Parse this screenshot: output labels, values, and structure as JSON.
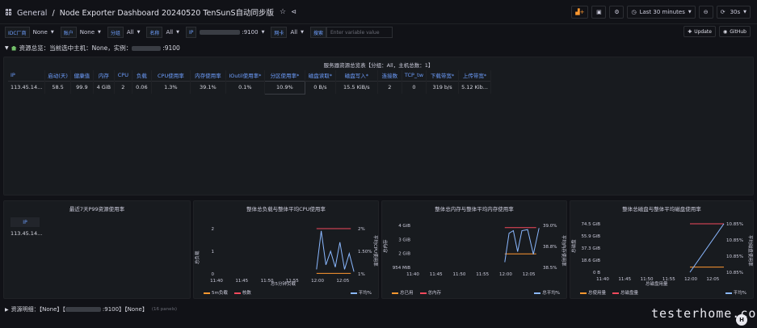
{
  "header": {
    "breadcrumb_home": "General",
    "separator": "/",
    "dashboard_title": "Node Exporter Dashboard 20240520 TenSunS自动同步版",
    "time_range": "Last 30 minutes",
    "refresh_interval": "30s"
  },
  "variables": [
    {
      "label": "IDC厂商",
      "value": "None"
    },
    {
      "label": "账户",
      "value": "None"
    },
    {
      "label": "分组",
      "value": "All"
    },
    {
      "label": "名称",
      "value": "All"
    },
    {
      "label": "IP",
      "value": ":9100"
    },
    {
      "label": "网卡",
      "value": "All"
    }
  ],
  "var_search": {
    "label": "搜索",
    "placeholder": "Enter variable value"
  },
  "buttons": {
    "update": "Update",
    "github": "GitHub"
  },
  "row_overview": {
    "label": "资源总览：当前选中主机：None，实例：",
    "suffix": ":9100"
  },
  "summary_panel": {
    "title": "服务器资源总览表【分组：All，主机总数：1】",
    "columns": [
      "IP",
      "启动(天)",
      "健康值",
      "内存",
      "CPU",
      "负载",
      "CPU使用率",
      "内存使用率",
      "IOutil使用率*",
      "分区使用率*",
      "磁盘读取*",
      "磁盘写入*",
      "连接数",
      "TCP_tw",
      "下载带宽*",
      "上传带宽*"
    ],
    "row": [
      "113.45.14...",
      "58.5",
      "99.9",
      "4 GiB",
      "2",
      "0.06",
      "1.3%",
      "39.1%",
      "0.1%",
      "10.9%",
      "0 B/s",
      "15.5 KiB/s",
      "2",
      "0",
      "319 b/s",
      "5.12 Kib..."
    ]
  },
  "p99_panel": {
    "title": "最近7天P99资源使用率",
    "column": "IP",
    "value": "113.45.14..."
  },
  "cpu_panel": {
    "title": "整体总负载与整体平均CPU使用率",
    "left_axis_label": "总负载",
    "right_axis_label": "平均CPU使用率",
    "x_axis_label": "总5分钟负载",
    "legend": [
      "5m负载",
      "核数",
      "平均%"
    ]
  },
  "mem_panel": {
    "title": "整体总内存与整体平均内存使用率",
    "left_axis_label": "总内存",
    "right_axis_label": "平均内存使用率",
    "legend": [
      "总已用",
      "总内存",
      "总平均%"
    ]
  },
  "disk_panel": {
    "title": "整体总磁盘与整体平均磁盘使用率",
    "left_axis_label": "总磁盘",
    "right_axis_label": "平均磁盘使用率",
    "x_axis_label": "总磁盘用量",
    "legend": [
      "总使用量",
      "总磁盘量",
      "平均%"
    ]
  },
  "row_detail": {
    "label": "资源明细：【None】【",
    "middle": ":9100】【None】",
    "count": "(16 panels)"
  },
  "watermark": {
    "text": "testerhome.com",
    "logo": "H"
  },
  "colors": {
    "accent_blue": "#6e9fff",
    "orange": "#ff9830",
    "red": "#f2495c",
    "green": "#73bf69",
    "series_blue": "#8ab8ff"
  },
  "chart_data": [
    {
      "type": "line",
      "title": "整体总负载与整体平均CPU使用率",
      "x": [
        "11:40",
        "11:45",
        "11:50",
        "11:55",
        "12:00",
        "12:05"
      ],
      "ylim_left": [
        0,
        2
      ],
      "yticks_left": [
        0,
        1,
        2
      ],
      "ylim_right": [
        1,
        2
      ],
      "yticks_right": [
        "1%",
        "1.50%",
        "2%"
      ],
      "series": [
        {
          "name": "核数",
          "axis": "left",
          "points": [
            [
              0.0,
              2
            ],
            [
              0.22,
              2
            ]
          ]
        },
        {
          "name": "5m负载",
          "axis": "left",
          "points": [
            [
              0.0,
              0.02
            ],
            [
              0.22,
              0.02
            ]
          ]
        },
        {
          "name": "平均%",
          "axis": "right",
          "points": [
            [
              0.0,
              1.1
            ],
            [
              0.03,
              1.95
            ],
            [
              0.06,
              1.2
            ],
            [
              0.09,
              1.5
            ],
            [
              0.12,
              1.15
            ],
            [
              0.15,
              1.7
            ],
            [
              0.18,
              1.1
            ],
            [
              0.21,
              1.45
            ],
            [
              0.24,
              1.05
            ]
          ]
        }
      ]
    },
    {
      "type": "line",
      "title": "整体总内存与整体平均内存使用率",
      "x": [
        "11:40",
        "11:45",
        "11:50",
        "11:55",
        "12:00",
        "12:05"
      ],
      "yticks_left": [
        "954 MiB",
        "2 GiB",
        "3 GiB",
        "4 GiB"
      ],
      "yticks_right": [
        "38.5%",
        "38.8%",
        "39.0%"
      ],
      "series": [
        {
          "name": "总内存",
          "axis": "left",
          "points": [
            [
              0.0,
              4
            ],
            [
              0.22,
              4
            ]
          ]
        },
        {
          "name": "总已用",
          "axis": "left",
          "points": [
            [
              0.0,
              1.55
            ],
            [
              0.22,
              1.55
            ]
          ]
        },
        {
          "name": "总平均%",
          "axis": "right",
          "points": [
            [
              0.0,
              38.4
            ],
            [
              0.03,
              38.95
            ],
            [
              0.06,
              39.0
            ],
            [
              0.09,
              38.6
            ],
            [
              0.12,
              39.0
            ],
            [
              0.16,
              39.02
            ],
            [
              0.2,
              38.55
            ],
            [
              0.24,
              39.05
            ]
          ]
        }
      ]
    },
    {
      "type": "line",
      "title": "整体总磁盘与整体平均磁盘使用率",
      "x": [
        "11:40",
        "11:45",
        "11:50",
        "11:55",
        "12:00",
        "12:05"
      ],
      "yticks_left": [
        "0 B",
        "18.6 GiB",
        "37.3 GiB",
        "55.9 GiB",
        "74.5 GiB"
      ],
      "yticks_right": [
        "10.85%",
        "10.85%",
        "10.85%",
        "10.85%"
      ],
      "series": [
        {
          "name": "总磁盘量",
          "axis": "left",
          "points": [
            [
              0.0,
              74.5
            ],
            [
              0.25,
              74.5
            ]
          ]
        },
        {
          "name": "总使用量",
          "axis": "left",
          "points": [
            [
              0.0,
              8
            ],
            [
              0.25,
              8
            ]
          ]
        },
        {
          "name": "平均%",
          "axis": "right",
          "points": [
            [
              0.0,
              0.0
            ],
            [
              0.25,
              1.0
            ]
          ]
        }
      ]
    }
  ]
}
